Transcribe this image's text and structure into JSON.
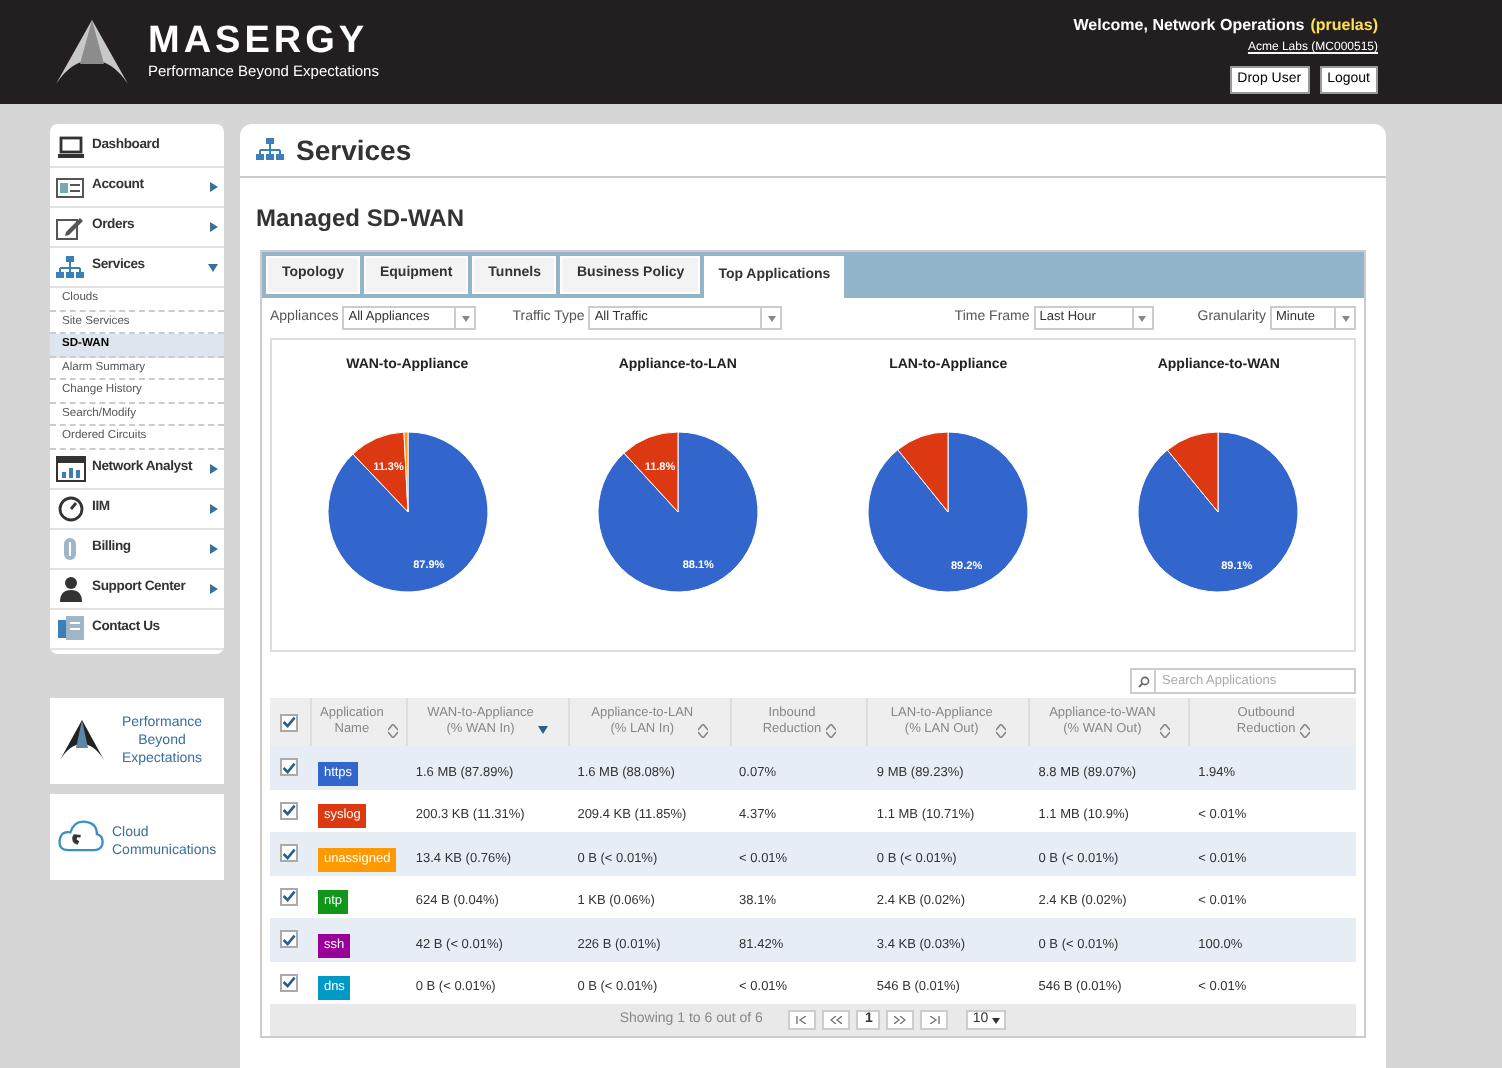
{
  "header": {
    "brand": "MASERGY",
    "tagline": "Performance Beyond Expectations",
    "welcome": "Welcome, Network Operations",
    "username": "(pruelas)",
    "account": "Acme Labs (MC000515)",
    "buttons": [
      "Drop User",
      "Logout"
    ]
  },
  "sidebar": {
    "items": [
      {
        "label": "Dashboard"
      },
      {
        "label": "Account",
        "expanded": false
      },
      {
        "label": "Orders",
        "expanded": false
      },
      {
        "label": "Services",
        "expanded": true,
        "children": [
          {
            "label": "Clouds",
            "selected": false
          },
          {
            "label": "Site Services",
            "selected": false
          },
          {
            "label": "SD-WAN",
            "selected": true
          },
          {
            "label": "Alarm Summary",
            "selected": false
          },
          {
            "label": "Change History",
            "selected": false
          },
          {
            "label": "Search/Modify",
            "selected": false
          },
          {
            "label": "Ordered Circuits",
            "selected": false
          }
        ]
      },
      {
        "label": "Network Analyst",
        "expanded": false
      },
      {
        "label": "IIM",
        "expanded": false
      },
      {
        "label": "Billing",
        "expanded": false
      },
      {
        "label": "Support Center",
        "expanded": false
      },
      {
        "label": "Contact Us"
      }
    ],
    "promos": [
      "Performance Beyond Expectations",
      "Cloud Communications"
    ]
  },
  "page": {
    "title": "Services",
    "subtitle": "Managed SD-WAN"
  },
  "tabs": [
    {
      "label": "Topology",
      "selected": false
    },
    {
      "label": "Equipment",
      "selected": false
    },
    {
      "label": "Tunnels",
      "selected": false
    },
    {
      "label": "Business Policy",
      "selected": false
    },
    {
      "label": "Top Applications",
      "selected": true
    }
  ],
  "filters": [
    {
      "label": "Appliances",
      "value": "All Appliances"
    },
    {
      "label": "Traffic Type",
      "value": "All Traffic"
    },
    {
      "label": "Time Frame",
      "value": "Last Hour"
    },
    {
      "label": "Granularity",
      "value": "Minute"
    }
  ],
  "charts": [
    {
      "chart_data": {
        "type": "pie",
        "title": "WAN-to-Appliance",
        "values": [
          87.9,
          11.3,
          0.8
        ],
        "value_labels": [
          "87.9%",
          "11.3%",
          null
        ]
      }
    },
    {
      "chart_data": {
        "type": "pie",
        "title": "Appliance-to-LAN",
        "values": [
          88.1,
          11.8
        ],
        "value_labels": [
          "88.1%",
          "11.8%"
        ]
      }
    },
    {
      "chart_data": {
        "type": "pie",
        "title": "LAN-to-Appliance",
        "values": [
          89.2,
          10.8
        ],
        "value_labels": [
          "89.2%",
          null
        ]
      }
    },
    {
      "chart_data": {
        "type": "pie",
        "title": "Appliance-to-WAN",
        "values": [
          89.1,
          10.9
        ],
        "value_labels": [
          "89.1%",
          null
        ]
      }
    }
  ],
  "search": {
    "placeholder": "Search Applications"
  },
  "table": {
    "all_checked": true,
    "columns": [
      {
        "lines": [
          "Application",
          "Name"
        ],
        "sorted": false,
        "kind": "tag"
      },
      {
        "lines": [
          "WAN-to-Appliance",
          "(% WAN In)"
        ],
        "sorted": true
      },
      {
        "lines": [
          "Appliance-to-LAN",
          "(% LAN In)"
        ],
        "sorted": false
      },
      {
        "lines": [
          "Inbound",
          "Reduction"
        ],
        "sorted": false
      },
      {
        "lines": [
          "LAN-to-Appliance",
          "(% LAN Out)"
        ],
        "sorted": false
      },
      {
        "lines": [
          "Appliance-to-WAN",
          "(% WAN Out)"
        ],
        "sorted": false
      },
      {
        "lines": [
          "Outbound",
          "Reduction"
        ],
        "sorted": false
      }
    ],
    "rows": [
      {
        "checked": true,
        "color": "#3366cc",
        "cells": [
          "https",
          "1.6 MB (87.89%)",
          "1.6 MB (88.08%)",
          "0.07%",
          "9 MB (89.23%)",
          "8.8 MB (89.07%)",
          "1.94%"
        ]
      },
      {
        "checked": true,
        "color": "#dc3912",
        "cells": [
          "syslog",
          "200.3 KB (11.31%)",
          "209.4 KB (11.85%)",
          "4.37%",
          "1.1 MB (10.71%)",
          "1.1 MB (10.9%)",
          "< 0.01%"
        ]
      },
      {
        "checked": true,
        "color": "#ff9900",
        "cells": [
          "unassigned",
          "13.4 KB (0.76%)",
          "0 B (< 0.01%)",
          "< 0.01%",
          "0 B (< 0.01%)",
          "0 B (< 0.01%)",
          "< 0.01%"
        ]
      },
      {
        "checked": true,
        "color": "#109618",
        "cells": [
          "ntp",
          "624 B (0.04%)",
          "1 KB (0.06%)",
          "38.1%",
          "2.4 KB (0.02%)",
          "2.4 KB (0.02%)",
          "< 0.01%"
        ]
      },
      {
        "checked": true,
        "color": "#990099",
        "cells": [
          "ssh",
          "42 B (< 0.01%)",
          "226 B (0.01%)",
          "81.42%",
          "3.4 KB (0.03%)",
          "0 B (< 0.01%)",
          "100.0%"
        ]
      },
      {
        "checked": true,
        "color": "#0099c6",
        "cells": [
          "dns",
          "0 B (< 0.01%)",
          "0 B (< 0.01%)",
          "< 0.01%",
          "546 B (0.01%)",
          "546 B (0.01%)",
          "< 0.01%"
        ]
      }
    ]
  },
  "pagination": {
    "summary": "Showing 1 to 6 out of 6",
    "page": "1",
    "page_size": "10"
  }
}
